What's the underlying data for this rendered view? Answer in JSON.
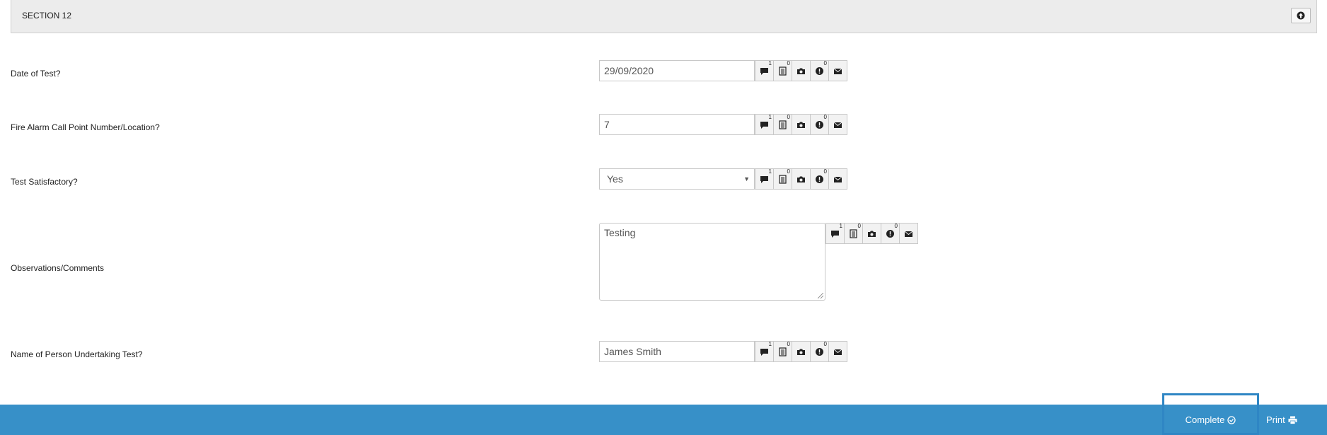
{
  "section": {
    "title": "SECTION 12",
    "collapse_icon": "arrow-up-circle-icon"
  },
  "questions": [
    {
      "label": "Date of Test?",
      "type": "text",
      "value": "29/09/2020",
      "badges": {
        "comment": "1",
        "notes": "0",
        "alert": "0"
      }
    },
    {
      "label": "Fire Alarm Call Point Number/Location?",
      "type": "text",
      "value": "7",
      "badges": {
        "comment": "1",
        "notes": "0",
        "alert": "0"
      }
    },
    {
      "label": "Test Satisfactory?",
      "type": "select",
      "value": "Yes",
      "badges": {
        "comment": "1",
        "notes": "0",
        "alert": "0"
      }
    },
    {
      "label": "Observations/Comments",
      "type": "textarea",
      "value": "Testing",
      "badges": {
        "comment": "1",
        "notes": "0",
        "alert": "0"
      }
    },
    {
      "label": "Name of Person Undertaking Test?",
      "type": "text",
      "value": "James Smith",
      "badges": {
        "comment": "1",
        "notes": "0",
        "alert": "0"
      }
    }
  ],
  "icons": [
    "comment-icon",
    "notes-icon",
    "camera-icon",
    "alert-icon",
    "email-icon"
  ],
  "footer": {
    "complete_label": "Complete",
    "print_label": "Print",
    "bar_color": "#3790c8"
  }
}
